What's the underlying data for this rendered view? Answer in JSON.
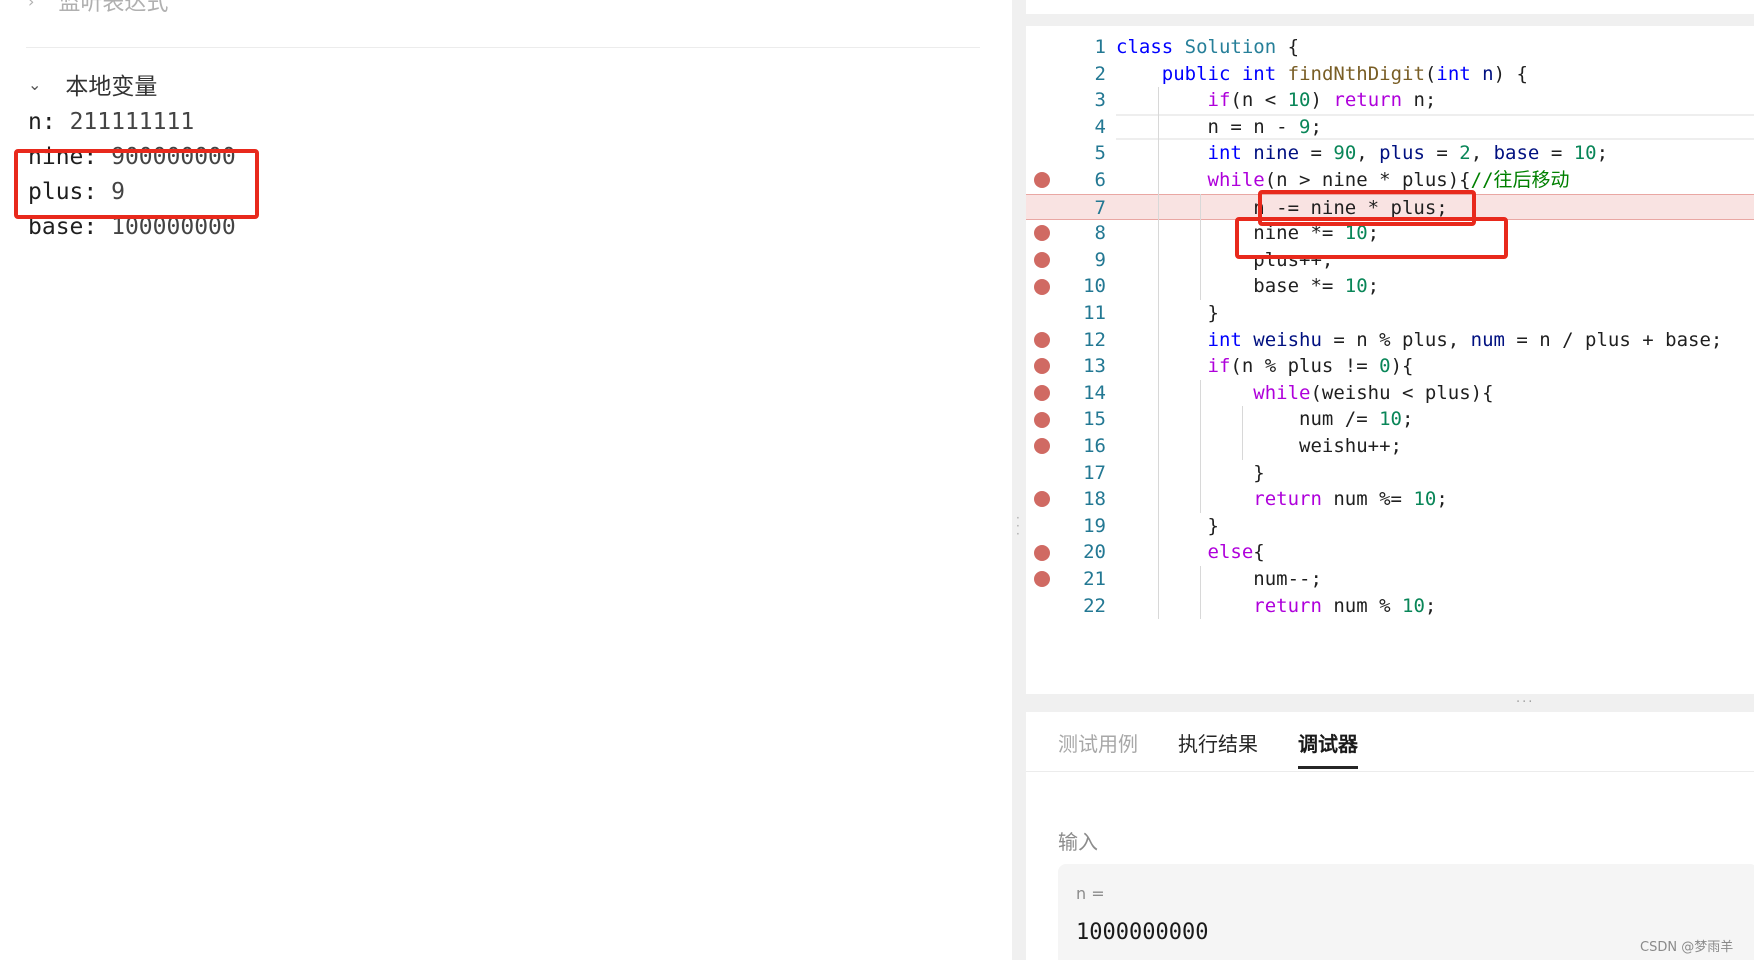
{
  "debugger": {
    "watch_label": "监听表达式",
    "locals_label": "本地变量",
    "variables": [
      {
        "name": "n:",
        "value": "211111111"
      },
      {
        "name": "nine:",
        "value": "900000000"
      },
      {
        "name": "plus:",
        "value": "9"
      },
      {
        "name": "base:",
        "value": "100000000"
      }
    ]
  },
  "editor": {
    "lines": [
      {
        "num": "1",
        "breakpoint": false,
        "tokens": [
          {
            "t": "class",
            "c": "kw"
          },
          {
            "t": " "
          },
          {
            "t": "Solution",
            "c": "cls"
          },
          {
            "t": " {"
          }
        ]
      },
      {
        "num": "2",
        "breakpoint": false,
        "tokens": [
          {
            "t": "    "
          },
          {
            "t": "public",
            "c": "kw"
          },
          {
            "t": " "
          },
          {
            "t": "int",
            "c": "ty"
          },
          {
            "t": " "
          },
          {
            "t": "findNthDigit",
            "c": "fn"
          },
          {
            "t": "("
          },
          {
            "t": "int",
            "c": "ty"
          },
          {
            "t": " "
          },
          {
            "t": "n",
            "c": "var"
          },
          {
            "t": ") {"
          }
        ]
      },
      {
        "num": "3",
        "breakpoint": false,
        "tokens": [
          {
            "t": "        "
          },
          {
            "t": "if",
            "c": "kw2"
          },
          {
            "t": "(n < "
          },
          {
            "t": "10",
            "c": "num"
          },
          {
            "t": ") "
          },
          {
            "t": "return",
            "c": "kw2"
          },
          {
            "t": " n;"
          }
        ]
      },
      {
        "num": "4",
        "breakpoint": false,
        "tokens": [
          {
            "t": "        n = n - "
          },
          {
            "t": "9",
            "c": "num"
          },
          {
            "t": ";"
          }
        ]
      },
      {
        "num": "5",
        "breakpoint": false,
        "tokens": [
          {
            "t": "        "
          },
          {
            "t": "int",
            "c": "ty"
          },
          {
            "t": " "
          },
          {
            "t": "nine",
            "c": "var"
          },
          {
            "t": " = "
          },
          {
            "t": "90",
            "c": "num"
          },
          {
            "t": ", "
          },
          {
            "t": "plus",
            "c": "var"
          },
          {
            "t": " = "
          },
          {
            "t": "2",
            "c": "num"
          },
          {
            "t": ", "
          },
          {
            "t": "base",
            "c": "var"
          },
          {
            "t": " = "
          },
          {
            "t": "10",
            "c": "num"
          },
          {
            "t": ";"
          }
        ]
      },
      {
        "num": "6",
        "breakpoint": true,
        "tokens": [
          {
            "t": "        "
          },
          {
            "t": "while",
            "c": "kw2"
          },
          {
            "t": "(n > nine * plus){"
          },
          {
            "t": "//往后移动",
            "c": "cm"
          }
        ]
      },
      {
        "num": "7",
        "breakpoint": false,
        "tokens": [
          {
            "t": "            n -= nine * plus;"
          }
        ]
      },
      {
        "num": "8",
        "breakpoint": true,
        "tokens": [
          {
            "t": "            nine *= "
          },
          {
            "t": "10",
            "c": "num"
          },
          {
            "t": ";"
          }
        ]
      },
      {
        "num": "9",
        "breakpoint": true,
        "tokens": [
          {
            "t": "            plus++;"
          }
        ]
      },
      {
        "num": "10",
        "breakpoint": true,
        "tokens": [
          {
            "t": "            base *= "
          },
          {
            "t": "10",
            "c": "num"
          },
          {
            "t": ";"
          }
        ]
      },
      {
        "num": "11",
        "breakpoint": false,
        "tokens": [
          {
            "t": "        }"
          }
        ]
      },
      {
        "num": "12",
        "breakpoint": true,
        "tokens": [
          {
            "t": "        "
          },
          {
            "t": "int",
            "c": "ty"
          },
          {
            "t": " "
          },
          {
            "t": "weishu",
            "c": "var"
          },
          {
            "t": " = n % plus, "
          },
          {
            "t": "num",
            "c": "var"
          },
          {
            "t": " = n / plus + base;"
          }
        ]
      },
      {
        "num": "13",
        "breakpoint": true,
        "tokens": [
          {
            "t": "        "
          },
          {
            "t": "if",
            "c": "kw2"
          },
          {
            "t": "(n % plus != "
          },
          {
            "t": "0",
            "c": "num"
          },
          {
            "t": "){"
          }
        ]
      },
      {
        "num": "14",
        "breakpoint": true,
        "tokens": [
          {
            "t": "            "
          },
          {
            "t": "while",
            "c": "kw2"
          },
          {
            "t": "(weishu < plus){"
          }
        ]
      },
      {
        "num": "15",
        "breakpoint": true,
        "tokens": [
          {
            "t": "                num /= "
          },
          {
            "t": "10",
            "c": "num"
          },
          {
            "t": ";"
          }
        ]
      },
      {
        "num": "16",
        "breakpoint": true,
        "tokens": [
          {
            "t": "                weishu++;"
          }
        ]
      },
      {
        "num": "17",
        "breakpoint": false,
        "tokens": [
          {
            "t": "            }"
          }
        ]
      },
      {
        "num": "18",
        "breakpoint": true,
        "tokens": [
          {
            "t": "            "
          },
          {
            "t": "return",
            "c": "kw2"
          },
          {
            "t": " num %= "
          },
          {
            "t": "10",
            "c": "num"
          },
          {
            "t": ";"
          }
        ]
      },
      {
        "num": "19",
        "breakpoint": false,
        "tokens": [
          {
            "t": "        }"
          }
        ]
      },
      {
        "num": "20",
        "breakpoint": true,
        "tokens": [
          {
            "t": "        "
          },
          {
            "t": "else",
            "c": "kw2"
          },
          {
            "t": "{"
          }
        ]
      },
      {
        "num": "21",
        "breakpoint": true,
        "tokens": [
          {
            "t": "            num--;"
          }
        ]
      },
      {
        "num": "22",
        "breakpoint": false,
        "tokens": [
          {
            "t": "            "
          },
          {
            "t": "return",
            "c": "kw2"
          },
          {
            "t": " num % "
          },
          {
            "t": "10",
            "c": "num"
          },
          {
            "t": ";"
          }
        ]
      }
    ]
  },
  "panel": {
    "tabs": [
      "测试用例",
      "执行结果",
      "调试器"
    ],
    "active_tab": "调试器",
    "input_title": "输入",
    "input_label": "n =",
    "input_value": "1000000000"
  },
  "watermark": "CSDN @梦雨羊",
  "colors": {
    "annotation_box": "#e8291c",
    "breakpoint": "#d06a63",
    "current_line": "#f9e3e2"
  }
}
